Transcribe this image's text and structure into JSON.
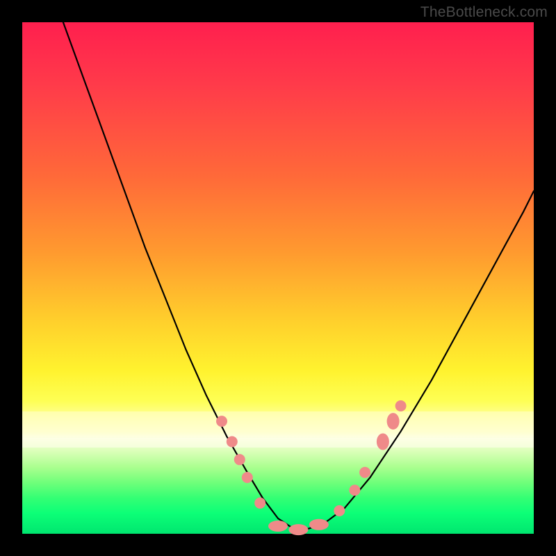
{
  "watermark": "TheBottleneck.com",
  "colors": {
    "frame": "#000000",
    "curve": "#000000",
    "marker": "#ef8a89",
    "gradient_top": "#ff1f4e",
    "gradient_bottom": "#00e66f"
  },
  "chart_data": {
    "type": "line",
    "title": "",
    "xlabel": "",
    "ylabel": "",
    "xlim": [
      0,
      100
    ],
    "ylim": [
      0,
      100
    ],
    "grid": false,
    "legend": false,
    "note": "Axes are unlabeled in the source image; values below are estimated in percent-of-plot-area coordinates (origin at bottom-left).",
    "series": [
      {
        "name": "curve",
        "x": [
          8,
          12,
          16,
          20,
          24,
          28,
          32,
          36,
          40,
          44,
          47,
          50,
          53,
          56,
          59,
          63,
          68,
          74,
          80,
          86,
          92,
          98,
          100
        ],
        "y": [
          100,
          89,
          78,
          67,
          56,
          46,
          36,
          27,
          19,
          12,
          7,
          3,
          1,
          1,
          2,
          5,
          11,
          20,
          30,
          41,
          52,
          63,
          67
        ]
      }
    ],
    "markers": {
      "name": "highlighted-points",
      "color": "#ef8a89",
      "points": [
        {
          "x": 39,
          "y": 22
        },
        {
          "x": 41,
          "y": 18
        },
        {
          "x": 42.5,
          "y": 14.5
        },
        {
          "x": 44,
          "y": 11
        },
        {
          "x": 46.5,
          "y": 6.0
        },
        {
          "x": 50,
          "y": 1.5
        },
        {
          "x": 54,
          "y": 0.8
        },
        {
          "x": 58,
          "y": 1.8
        },
        {
          "x": 62,
          "y": 4.5
        },
        {
          "x": 65,
          "y": 8.5
        },
        {
          "x": 67,
          "y": 12.0
        },
        {
          "x": 70.5,
          "y": 18.0
        },
        {
          "x": 72.5,
          "y": 22.0
        },
        {
          "x": 74,
          "y": 25.0
        }
      ]
    }
  }
}
